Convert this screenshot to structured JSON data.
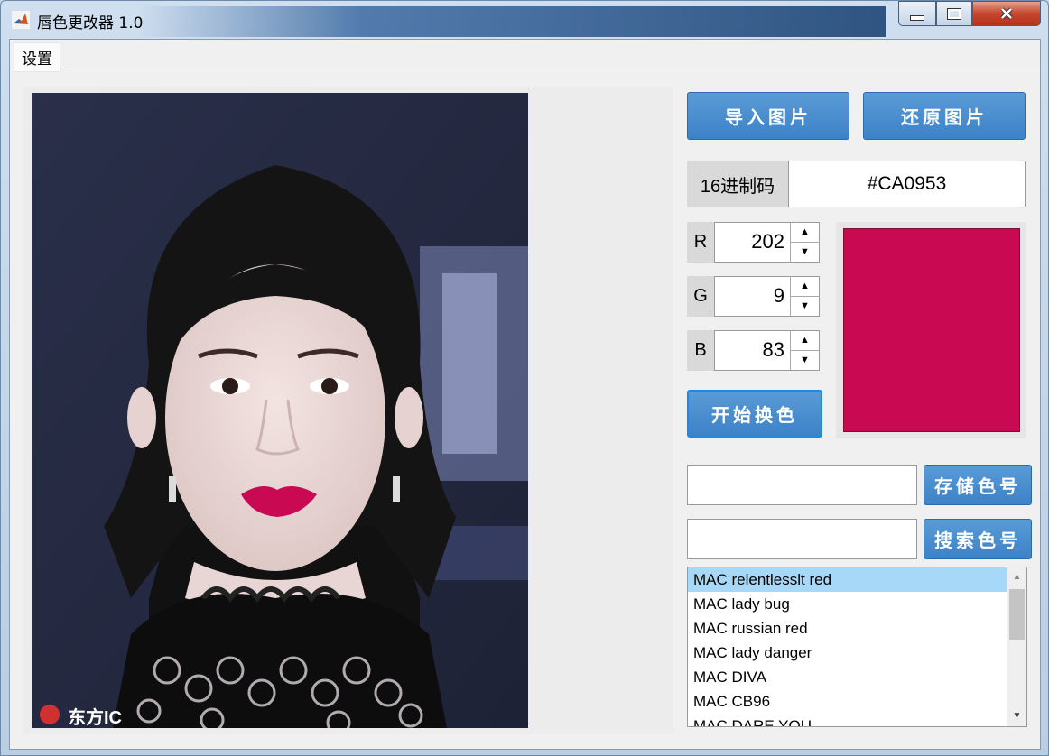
{
  "window": {
    "title": "唇色更改器 1.0"
  },
  "menu": {
    "items": [
      {
        "label": "设置"
      }
    ]
  },
  "photo": {
    "watermark": "东方IC"
  },
  "buttons": {
    "import": "导入图片",
    "restore": "还原图片",
    "apply": "开始换色",
    "save": "存储色号",
    "search": "搜索色号"
  },
  "hex": {
    "label": "16进制码",
    "value": "#CA0953"
  },
  "rgb": {
    "r_label": "R",
    "r_value": "202",
    "g_label": "G",
    "g_value": "9",
    "b_label": "B",
    "b_value": "83"
  },
  "preview": {
    "color": "#CA0953"
  },
  "save_field": {
    "value": ""
  },
  "search_field": {
    "value": ""
  },
  "color_list": {
    "items": [
      "MAC relentlesslt red",
      "MAC lady bug",
      "MAC russian red",
      "MAC lady danger",
      "MAC DIVA",
      "MAC CB96",
      "MAC DARE YOU"
    ],
    "selected_index": 0
  }
}
